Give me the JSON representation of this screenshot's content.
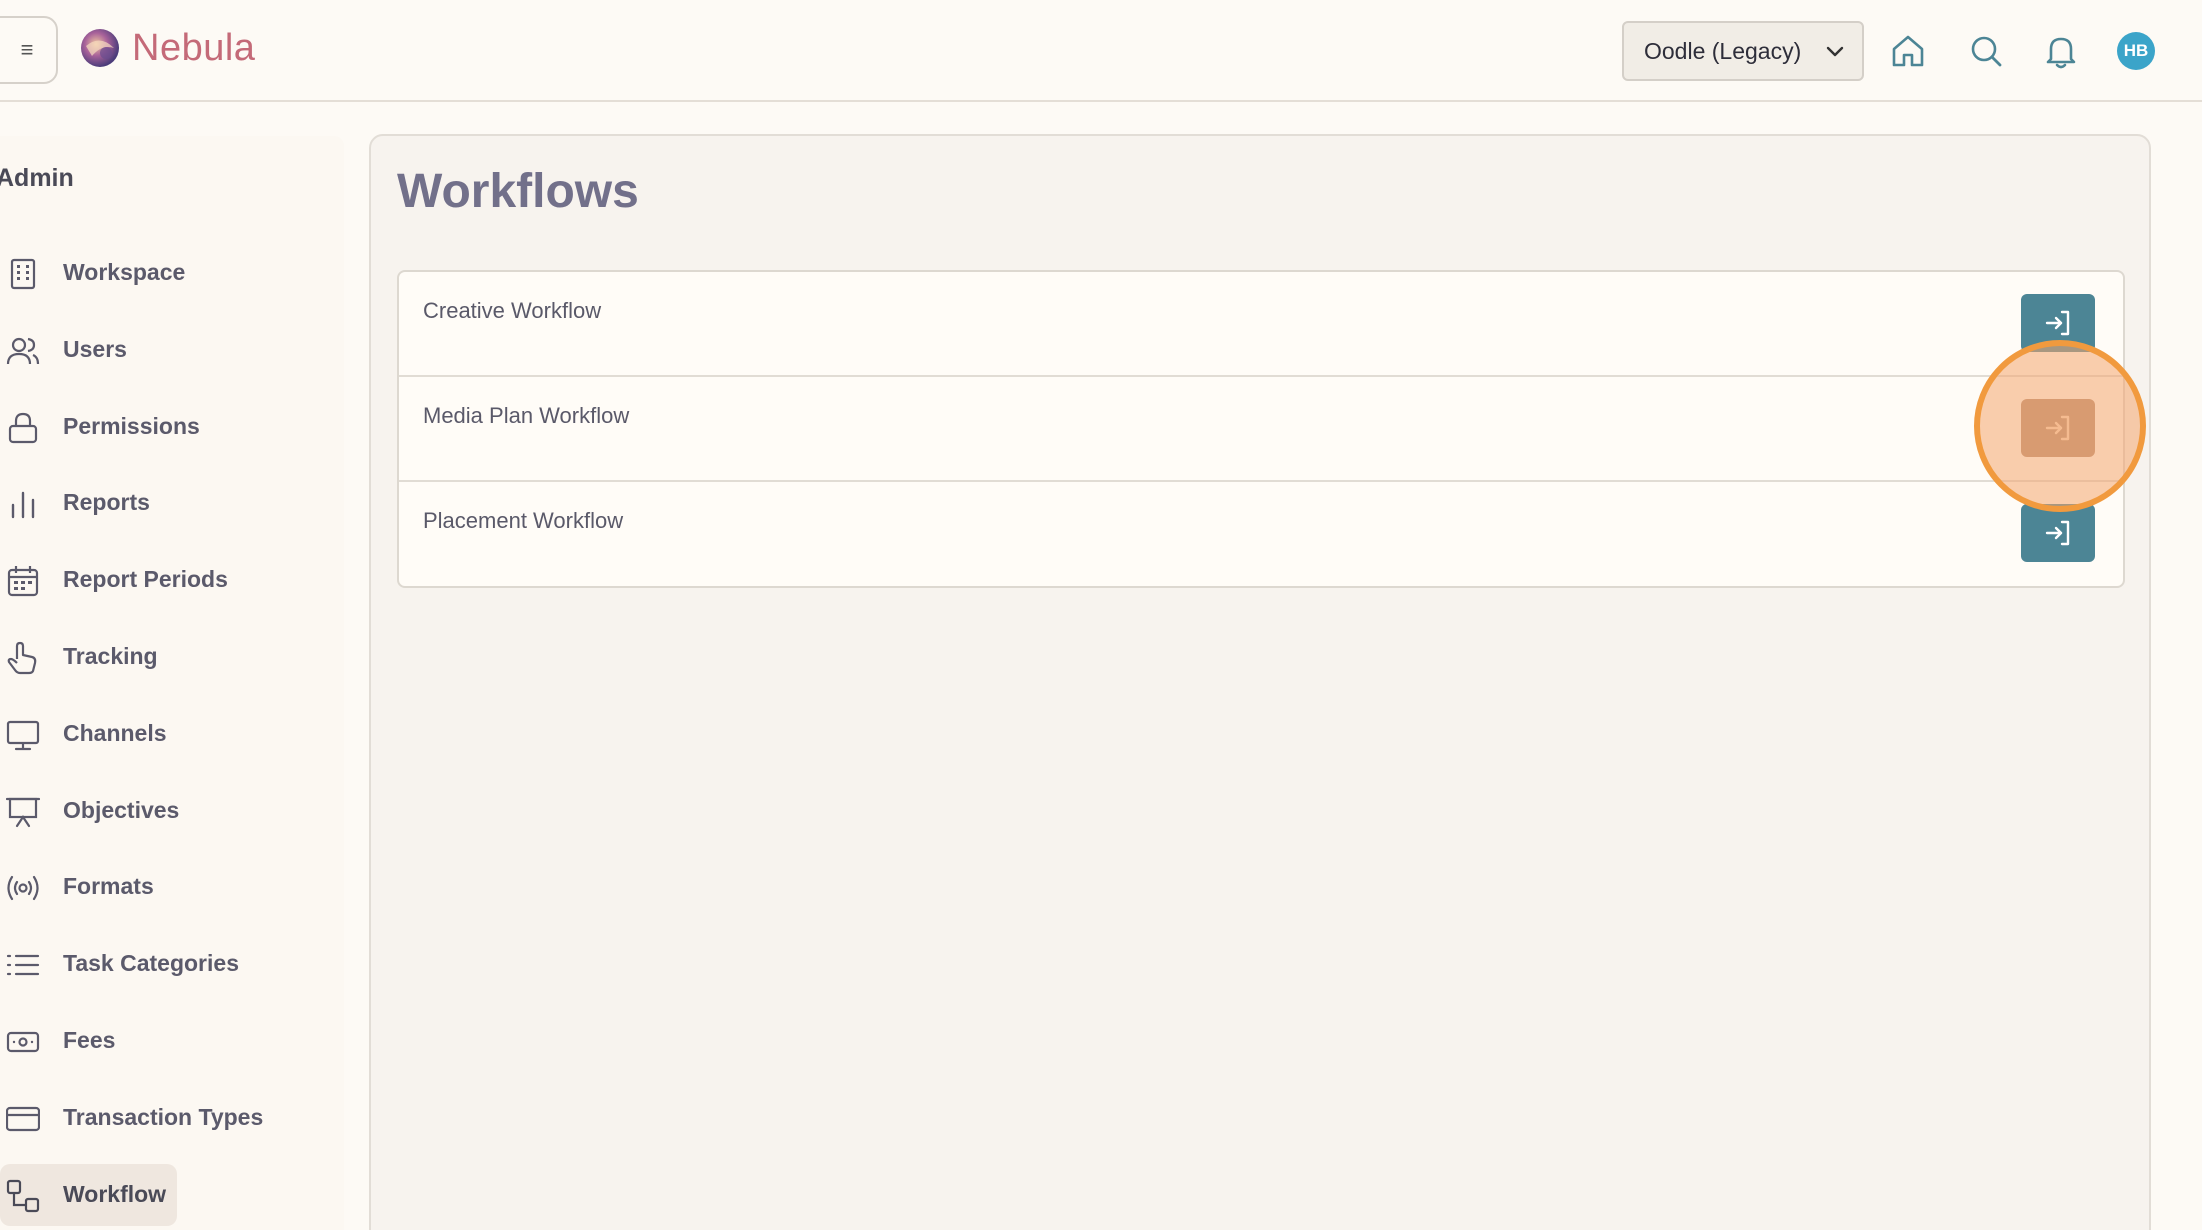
{
  "app": {
    "brand": "Nebula",
    "menu_glyph": "≡"
  },
  "header": {
    "account_selector": "Oodle (Legacy)",
    "icons": [
      "home-icon",
      "search-icon",
      "bell-icon"
    ],
    "avatar_initials": "HB",
    "avatar_color": "#3ba4c9"
  },
  "sidebar": {
    "section_title": "Admin",
    "items": [
      {
        "label": "Workspace",
        "icon": "building-icon"
      },
      {
        "label": "Users",
        "icon": "users-icon"
      },
      {
        "label": "Permissions",
        "icon": "lock-icon"
      },
      {
        "label": "Reports",
        "icon": "bar-chart-icon"
      },
      {
        "label": "Report Periods",
        "icon": "calendar-icon"
      },
      {
        "label": "Tracking",
        "icon": "pointer-hand-icon"
      },
      {
        "label": "Channels",
        "icon": "monitor-icon"
      },
      {
        "label": "Objectives",
        "icon": "presentation-icon"
      },
      {
        "label": "Formats",
        "icon": "broadcast-icon"
      },
      {
        "label": "Task Categories",
        "icon": "list-icon"
      },
      {
        "label": "Fees",
        "icon": "banknote-icon"
      },
      {
        "label": "Transaction Types",
        "icon": "credit-card-icon"
      },
      {
        "label": "Workflow",
        "icon": "workflow-icon",
        "active": true
      }
    ]
  },
  "main": {
    "title": "Workflows",
    "workflows": [
      {
        "name": "Creative Workflow"
      },
      {
        "name": "Media Plan Workflow",
        "highlighted": true
      },
      {
        "name": "Placement Workflow"
      }
    ],
    "action_icon": "enter-icon",
    "accent_color": "#4c8595",
    "highlight_color": "#f19a3e"
  }
}
